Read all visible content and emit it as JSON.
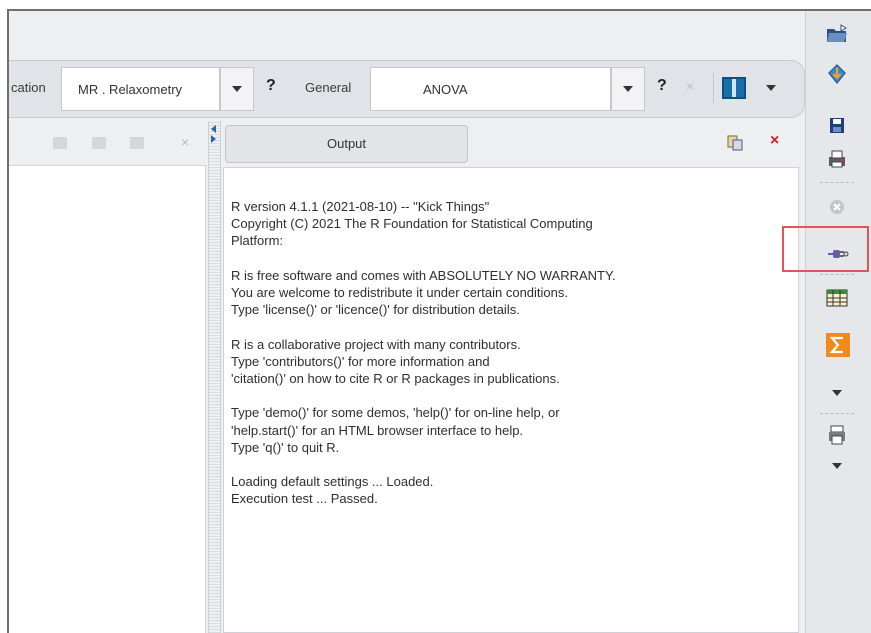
{
  "toolbar": {
    "left_label_partial": "cation",
    "model_value": "MR . Relaxometry",
    "help_label": "?",
    "stat_label": "General",
    "stat_value": "ANOVA",
    "help2_label": "?",
    "close_label": "×"
  },
  "left_panel": {
    "close_label": "×"
  },
  "output_tab": {
    "label": "Output",
    "close_label": "×"
  },
  "console": {
    "text": "R version 4.1.1 (2021-08-10) -- \"Kick Things\"\nCopyright (C) 2021 The R Foundation for Statistical Computing\nPlatform: \n\nR is free software and comes with ABSOLUTELY NO WARRANTY.\nYou are welcome to redistribute it under certain conditions.\nType 'license()' or 'licence()' for distribution details.\n\nR is a collaborative project with many contributors.\nType 'contributors()' for more information and\n'citation()' on how to cite R or R packages in publications.\n\nType 'demo()' for some demos, 'help()' for on-line help, or\n'help.start()' for an HTML browser interface to help.\nType 'q()' to quit R.\n\nLoading default settings ... Loaded.\nExecution test ... Passed."
  },
  "colors": {
    "highlight": "#e5525a",
    "close_red": "#d21e1e",
    "sigma_orange": "#f08a1c",
    "accent_blue": "#1b6fa8"
  },
  "right_toolbar_icons": [
    "open-folder-icon",
    "import-arrow-icon",
    "save-disk-icon",
    "print-icon",
    "stop-icon",
    "connect-plug-icon",
    "table-icon",
    "sigma-icon",
    "dropdown-arrow-icon",
    "printer-config-icon",
    "dropdown-arrow-icon"
  ]
}
